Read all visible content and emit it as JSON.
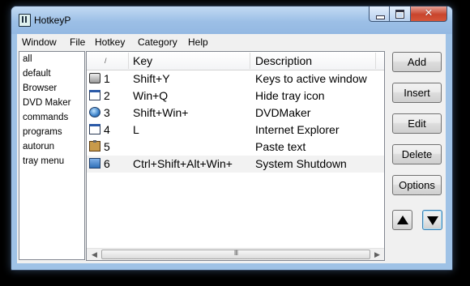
{
  "window": {
    "title": "HotkeyP"
  },
  "menu": [
    "Window",
    "File",
    "Hotkey",
    "Category",
    "Help"
  ],
  "categories": [
    "all",
    "default",
    "Browser",
    "DVD Maker",
    "commands",
    "programs",
    "autorun",
    "tray menu"
  ],
  "list": {
    "columns": [
      "/",
      "Key",
      "Description"
    ],
    "rows": [
      {
        "icon": "keyboard-icon",
        "num": "1",
        "key": "Shift+Y",
        "desc": "Keys to active window"
      },
      {
        "icon": "window-icon",
        "num": "2",
        "key": "Win+Q",
        "desc": "Hide tray icon"
      },
      {
        "icon": "dvd-icon",
        "num": "3",
        "key": "Shift+Win+",
        "desc": "DVDMaker"
      },
      {
        "icon": "window-icon",
        "num": "4",
        "key": "L",
        "desc": "Internet Explorer"
      },
      {
        "icon": "clipboard-icon",
        "num": "5",
        "key": "",
        "desc": "Paste text"
      },
      {
        "icon": "computer-icon",
        "num": "6",
        "key": "Ctrl+Shift+Alt+Win+",
        "desc": "System Shutdown"
      }
    ],
    "scroll_grip": "III"
  },
  "buttons": {
    "add": "Add",
    "insert": "Insert",
    "edit": "Edit",
    "delete": "Delete",
    "options": "Options"
  }
}
